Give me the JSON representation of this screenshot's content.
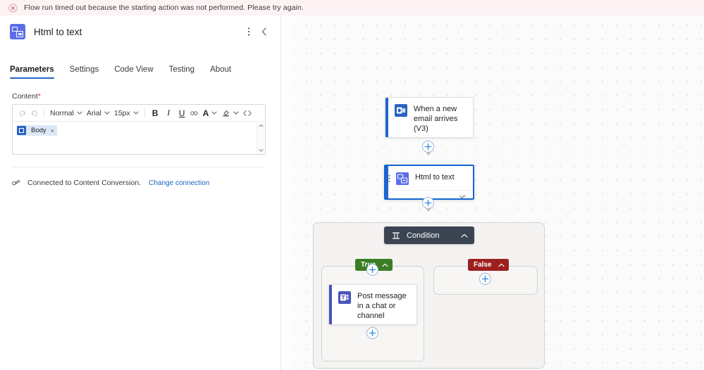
{
  "banner": {
    "icon": "error-circle-icon",
    "message": "Flow run timed out because the starting action was not performed. Please try again."
  },
  "panel": {
    "icon": "html-to-text-icon",
    "title": "Html to text",
    "more_icon": "more-vertical-icon",
    "collapse_icon": "chevron-left-icon",
    "tabs": [
      {
        "label": "Parameters",
        "active": true
      },
      {
        "label": "Settings",
        "active": false
      },
      {
        "label": "Code View",
        "active": false
      },
      {
        "label": "Testing",
        "active": false
      },
      {
        "label": "About",
        "active": false
      }
    ],
    "field": {
      "label": "Content",
      "required_marker": "*",
      "toolbar": {
        "undo_icon": "undo-icon",
        "redo_icon": "redo-icon",
        "style": "Normal",
        "font": "Arial",
        "size": "15px",
        "bold": "B",
        "italic": "I",
        "underline": "U",
        "link_icon": "link-icon",
        "font_color": "A",
        "highlight_icon": "highlight-icon",
        "code_icon": "code-brackets-icon"
      },
      "token": {
        "icon": "outlook-icon",
        "label": "Body",
        "remove": "×"
      },
      "scroll_up_icon": "scroll-up-arrow",
      "scroll_down_icon": "scroll-down-arrow"
    },
    "connection": {
      "icon": "plug-icon",
      "text": "Connected to Content Conversion.",
      "link": "Change connection"
    }
  },
  "canvas": {
    "nodes": [
      {
        "id": "trigger",
        "title": "When a new email arrives (V3)",
        "icon": "outlook-icon",
        "accent": "#2266cc",
        "footer_icon": "link-icon",
        "selected": false
      },
      {
        "id": "html-to-text",
        "title": "Html to text",
        "icon": "html-to-text-icon",
        "accent": "#2266cc",
        "footer_icon": "link-icon",
        "selected": true
      },
      {
        "id": "post-message",
        "title": "Post message in a chat or channel",
        "icon": "teams-icon",
        "accent": "#4b53bc",
        "footer_icon": "link-icon",
        "selected": false
      }
    ],
    "condition": {
      "title": "Condition",
      "icon": "condition-icon",
      "collapse_icon": "chevron-up-icon",
      "color": "#3b4552"
    },
    "branches": [
      {
        "label": "True",
        "color": "#3a7d22",
        "chevron": "chevron-up-icon"
      },
      {
        "label": "False",
        "color": "#9c2020",
        "chevron": "chevron-up-icon"
      }
    ],
    "add_button_icon": "plus-icon",
    "accent_color": "#2266cc"
  }
}
